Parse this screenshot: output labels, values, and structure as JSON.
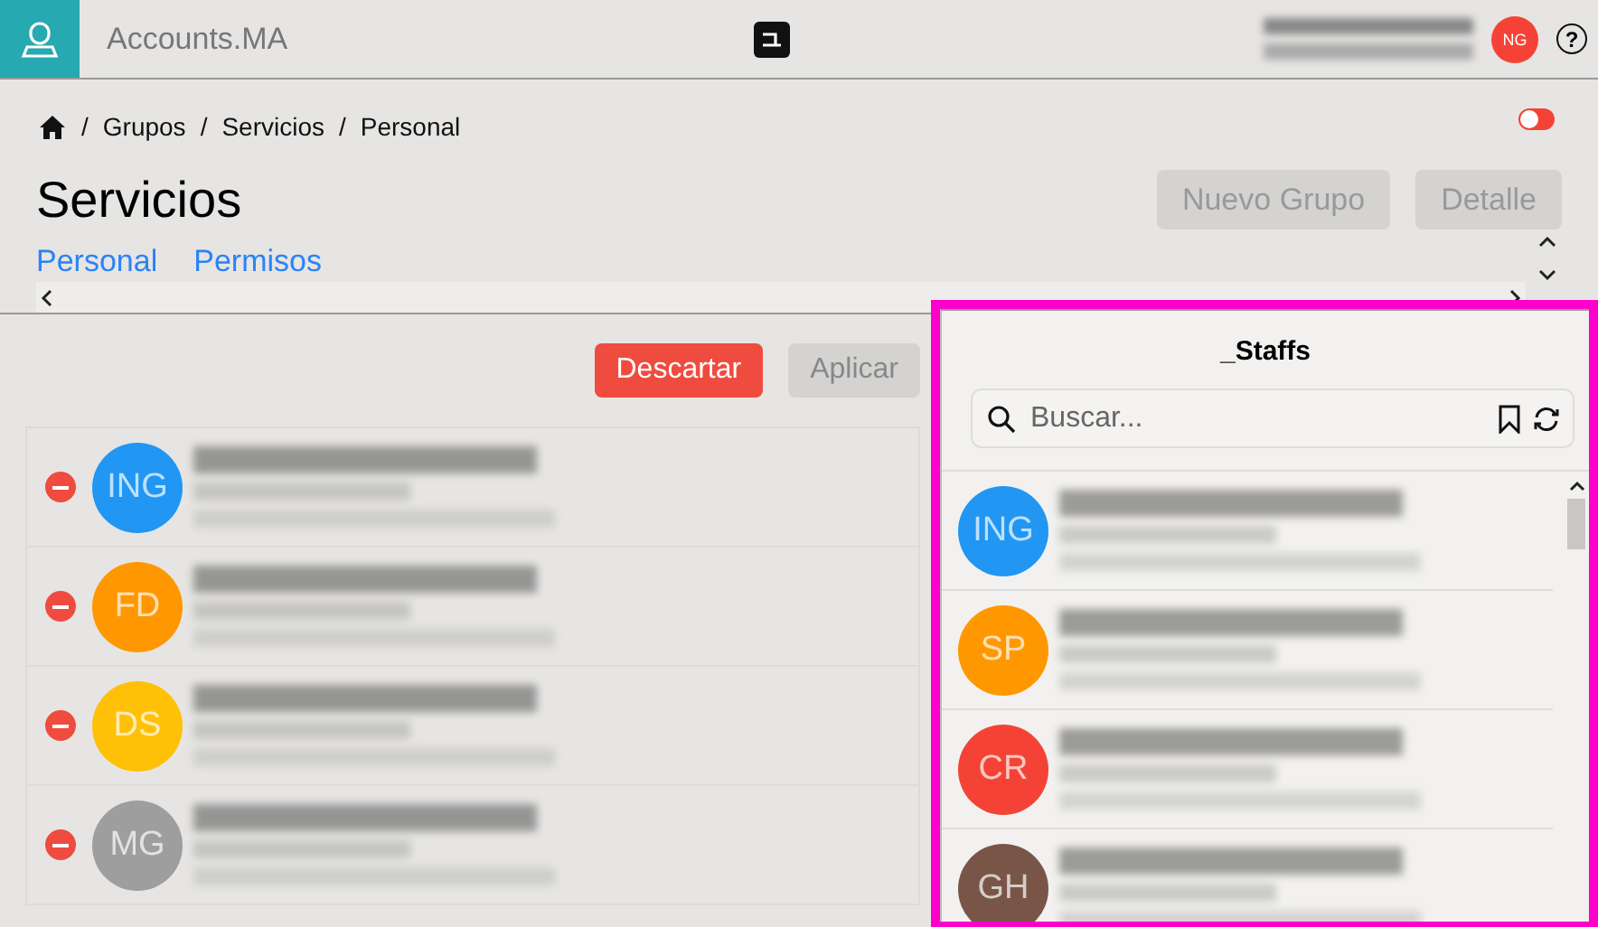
{
  "app": {
    "title": "Accounts.MA",
    "user_initials": "NG",
    "help": "?"
  },
  "breadcrumb": {
    "separator": "/",
    "items": [
      "Grupos",
      "Servicios",
      "Personal"
    ]
  },
  "toggle": {
    "on": false
  },
  "page": {
    "title": "Servicios",
    "buttons": [
      "Nuevo Grupo",
      "Detalle"
    ]
  },
  "tabs": [
    {
      "label": "Personal",
      "selected": false
    },
    {
      "label": "Permisos",
      "selected": false
    }
  ],
  "actions": {
    "discard": "Descartar",
    "apply": "Aplicar",
    "apply_disabled": true
  },
  "members": [
    {
      "initials": "ING",
      "color": "#2196f3"
    },
    {
      "initials": "FD",
      "color": "#ff9800"
    },
    {
      "initials": "DS",
      "color": "#ffc107"
    },
    {
      "initials": "MG",
      "color": "#9e9e9e"
    }
  ],
  "staff_panel": {
    "title": "_Staffs",
    "search_placeholder": "Buscar...",
    "items": [
      {
        "initials": "ING",
        "color": "#2196f3"
      },
      {
        "initials": "SP",
        "color": "#ff9800"
      },
      {
        "initials": "CR",
        "color": "#f44336"
      },
      {
        "initials": "GH",
        "color": "#795548"
      }
    ]
  }
}
